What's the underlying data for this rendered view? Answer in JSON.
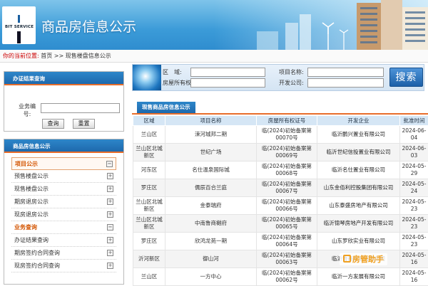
{
  "header": {
    "logo_text": "BIT SERVICE",
    "title": "商品房信息公示"
  },
  "breadcrumb": {
    "label": "你的当前位置:",
    "home": "首页",
    "sep": ">>",
    "current": "现售楼盘信息公示"
  },
  "cert_query": {
    "title": "办证结果查询",
    "field_label": "业务编号:",
    "field_value": "",
    "query_button": "查询",
    "reset_button": "重置"
  },
  "info_panel": {
    "title": "商品房信息公示",
    "items": [
      {
        "label": "项目公示",
        "type": "category",
        "icon": "minus"
      },
      {
        "label": "预售楼盘公示",
        "type": "item",
        "icon": "plus"
      },
      {
        "label": "现售楼盘公示",
        "type": "item",
        "icon": "plus"
      },
      {
        "label": "期房退房公示",
        "type": "item",
        "icon": "plus"
      },
      {
        "label": "现房退房公示",
        "type": "item",
        "icon": "plus"
      },
      {
        "label": "业务查询",
        "type": "category",
        "icon": "minus"
      },
      {
        "label": "办证结果查询",
        "type": "item",
        "icon": "plus"
      },
      {
        "label": "期房签约合同查询",
        "type": "item",
        "icon": "plus"
      },
      {
        "label": "现房签约合同查询",
        "type": "item",
        "icon": "plus"
      }
    ]
  },
  "search": {
    "district_label": "区　域:",
    "district_value": "",
    "project_label": "项目名称:",
    "project_value": "",
    "cert_label": "房屋所有权证号",
    "cert_value": "",
    "developer_label": "开发公司:",
    "developer_value": "",
    "button": "搜索"
  },
  "listing": {
    "tab": "现售商品房信息公示",
    "columns": [
      "区域",
      "项目名称",
      "房屋所有权证号",
      "开发企业",
      "批准时间"
    ],
    "rows": [
      {
        "area": "兰山区",
        "project": "涑河城邦二期",
        "cert": "临(2024)初始备案第00070号",
        "dev": "临沂鹏兴置业有限公司",
        "date": "2024-06-04"
      },
      {
        "area": "兰山区北城新区",
        "project": "世纪广场",
        "cert": "临(2024)初始备案第00069号",
        "dev": "临沂世纪信投置业有限公司",
        "date": "2024-06-03"
      },
      {
        "area": "河东区",
        "project": "名仕温泉国际城",
        "cert": "临(2024)初始备案第00068号",
        "dev": "临沂名仕置业有限公司",
        "date": "2024-05-29"
      },
      {
        "area": "罗庄区",
        "project": "儒辰百合兰庭",
        "cert": "临(2024)初始备案第00067号",
        "dev": "山东金佰利控股集团有限公司",
        "date": "2024-05-24"
      },
      {
        "area": "兰山区北城新区",
        "project": "金泰瑞府",
        "cert": "临(2024)初始备案第00066号",
        "dev": "山东泰盛房地产有限公司",
        "date": "2024-05-23"
      },
      {
        "area": "兰山区北城新区",
        "project": "中南鲁商樾府",
        "cert": "临(2024)初始备案第00065号",
        "dev": "临沂锦琴房地产开发有限公司",
        "date": "2024-05-23"
      },
      {
        "area": "罗庄区",
        "project": "欣鸿龙苑一期",
        "cert": "临(2024)初始备案第00064号",
        "dev": "山东罗欣实业有限公司",
        "date": "2024-05-23"
      },
      {
        "area": "沂河新区",
        "project": "御山河",
        "cert": "临(2024)初始备案第00063号",
        "dev": "临沂鲁商置业有限公司",
        "date": "2024-05-16"
      },
      {
        "area": "兰山区",
        "project": "一方中心",
        "cert": "临(2024)初始备案第00062号",
        "dev": "临沂一方发展有限公司",
        "date": "2024-05-16"
      }
    ]
  },
  "watermark": {
    "text": "房管助手"
  },
  "colors": {
    "header_blue": "#2d86c9",
    "accent_orange": "#e86d2a",
    "category_text": "#d35400",
    "breadcrumb_label": "#cc0000"
  }
}
